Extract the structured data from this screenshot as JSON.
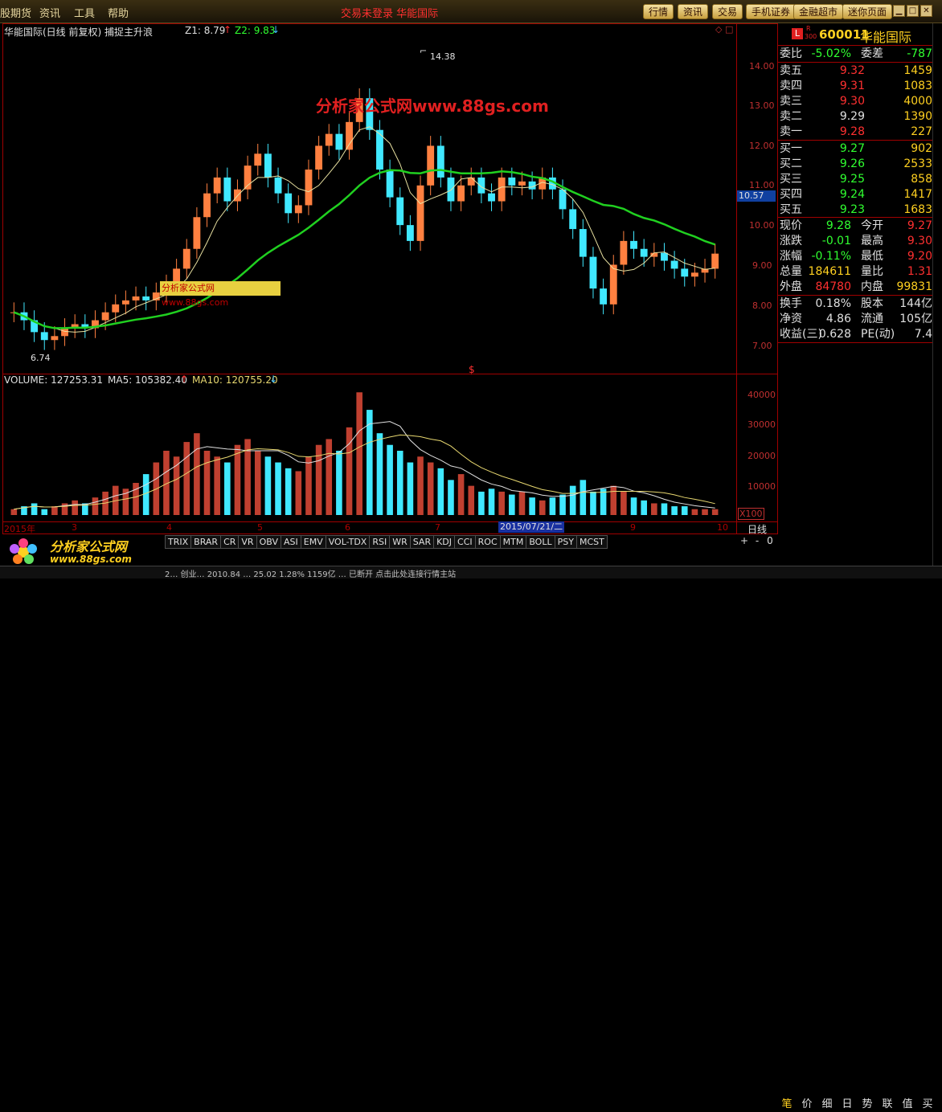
{
  "menu": {
    "items": [
      "股期货",
      "资讯",
      "工具",
      "帮助"
    ],
    "center": "交易未登录   华能国际"
  },
  "topbuttons": [
    "行情",
    "资讯",
    "交易",
    "手机证券",
    "金融超市",
    "迷你页面"
  ],
  "chart": {
    "title": "华能国际(日线 前复权) 捕捉主升浪",
    "z1": "Z1: 8.79",
    "z2": "Z2: 9.83",
    "watermark": "分析家公式网www.88gs.com",
    "watermark2": "分析家公式网www.88gs.com",
    "high_label": "14.38",
    "low_label": "6.74",
    "price_ticks": [
      "14.00",
      "13.00",
      "12.00",
      "11.00",
      "10.00",
      "9.00",
      "8.00",
      "7.00"
    ],
    "cursor_price": "10.57",
    "dollar": "$",
    "volume_info": "VOLUME: 127253.31",
    "ma5": "MA5: 105382.40",
    "ma10": "MA10: 120755.20",
    "vol_ticks": [
      "40000",
      "30000",
      "20000",
      "10000"
    ],
    "x100": "X100",
    "month_labels": [
      "2015年",
      "3",
      "4",
      "5",
      "6",
      "7",
      "8",
      "9",
      "10"
    ],
    "date_cursor": "2015/07/21/二",
    "period": "日线",
    "indicator_tabs": [
      "TRIX",
      "BRAR",
      "CR",
      "VR",
      "OBV",
      "ASI",
      "EMV",
      "VOL-TDX",
      "RSI",
      "WR",
      "SAR",
      "KDJ",
      "CCI",
      "ROC",
      "MTM",
      "BOLL",
      "PSY",
      "MCST"
    ],
    "ctrl_tabs": [
      "+",
      "-",
      "0"
    ]
  },
  "chart_data": {
    "type": "candlestick",
    "title": "华能国际(日线 前复权) 捕捉主升浪",
    "ylim": [
      6.5,
      14.6
    ],
    "high": 14.38,
    "low": 6.74,
    "close_series": [
      7.8,
      7.6,
      7.3,
      7.1,
      7.2,
      7.4,
      7.5,
      7.4,
      7.6,
      7.8,
      8.0,
      8.1,
      8.2,
      8.1,
      8.3,
      8.5,
      8.9,
      9.4,
      10.2,
      10.8,
      11.2,
      10.6,
      10.9,
      11.5,
      11.8,
      11.2,
      10.8,
      10.3,
      10.5,
      11.4,
      12.0,
      12.3,
      11.9,
      12.6,
      13.2,
      12.4,
      11.4,
      10.7,
      10.0,
      9.6,
      11.0,
      12.0,
      11.2,
      10.6,
      11.0,
      11.2,
      10.8,
      10.6,
      11.2,
      11.0,
      11.1,
      10.9,
      11.2,
      10.9,
      10.4,
      9.9,
      9.2,
      8.4,
      8.0,
      9.0,
      9.6,
      9.4,
      9.2,
      9.3,
      9.1,
      8.9,
      8.7,
      8.8,
      8.9,
      9.28
    ],
    "volume": [
      2,
      3,
      4,
      2,
      3,
      4,
      5,
      4,
      6,
      8,
      10,
      9,
      11,
      14,
      18,
      22,
      20,
      25,
      28,
      22,
      20,
      18,
      24,
      26,
      22,
      20,
      18,
      16,
      15,
      20,
      24,
      26,
      22,
      30,
      42,
      36,
      28,
      24,
      22,
      18,
      20,
      18,
      16,
      12,
      14,
      10,
      8,
      9,
      8,
      7,
      8,
      6,
      5,
      6,
      7,
      10,
      12,
      8,
      9,
      10,
      8,
      6,
      5,
      4,
      4,
      3,
      3,
      2,
      2,
      2
    ],
    "ma5_value": 105382.4,
    "ma10_value": 120755.2
  },
  "quote": {
    "logo_l": "L",
    "logo_r": "R",
    "logo_300": "300",
    "code": "600011",
    "name": "华能国际",
    "weibi_label": "委比",
    "weibi": "-5.02%",
    "weicha_label": "委差",
    "weicha": "-787",
    "asks": [
      {
        "label": "卖五",
        "price": "9.32",
        "vol": "1459"
      },
      {
        "label": "卖四",
        "price": "9.31",
        "vol": "1083"
      },
      {
        "label": "卖三",
        "price": "9.30",
        "vol": "4000"
      },
      {
        "label": "卖二",
        "price": "9.29",
        "vol": "1390"
      },
      {
        "label": "卖一",
        "price": "9.28",
        "vol": "227"
      }
    ],
    "bids": [
      {
        "label": "买一",
        "price": "9.27",
        "vol": "902"
      },
      {
        "label": "买二",
        "price": "9.26",
        "vol": "2533"
      },
      {
        "label": "买三",
        "price": "9.25",
        "vol": "858"
      },
      {
        "label": "买四",
        "price": "9.24",
        "vol": "1417"
      },
      {
        "label": "买五",
        "price": "9.23",
        "vol": "1683"
      }
    ],
    "stats1": [
      {
        "l1": "现价",
        "v1": "9.28",
        "l2": "今开",
        "v2": "9.27"
      },
      {
        "l1": "涨跌",
        "v1": "-0.01",
        "l2": "最高",
        "v2": "9.30"
      },
      {
        "l1": "涨幅",
        "v1": "-0.11%",
        "l2": "最低",
        "v2": "9.20"
      },
      {
        "l1": "总量",
        "v1": "184611",
        "l2": "量比",
        "v2": "1.31"
      },
      {
        "l1": "外盘",
        "v1": "84780",
        "l2": "内盘",
        "v2": "99831"
      }
    ],
    "stats2": [
      {
        "l1": "换手",
        "v1": "0.18%",
        "l2": "股本",
        "v2": "144亿"
      },
      {
        "l1": "净资",
        "v1": "4.86",
        "l2": "流通",
        "v2": "105亿"
      },
      {
        "l1": "收益(三)",
        "v1": "0.628",
        "l2": "PE(动)",
        "v2": "7.4"
      }
    ],
    "bottom_tabs": [
      "笔",
      "价",
      "细",
      "日",
      "势",
      "联",
      "值",
      "买"
    ]
  },
  "logo": {
    "text": "分析家公式网",
    "url": "www.88gs.com"
  },
  "statusbar": "2… 创业… 2010.84 … 25.02 1.28% 1159亿 … 已断开 点击此处连接行情主站"
}
